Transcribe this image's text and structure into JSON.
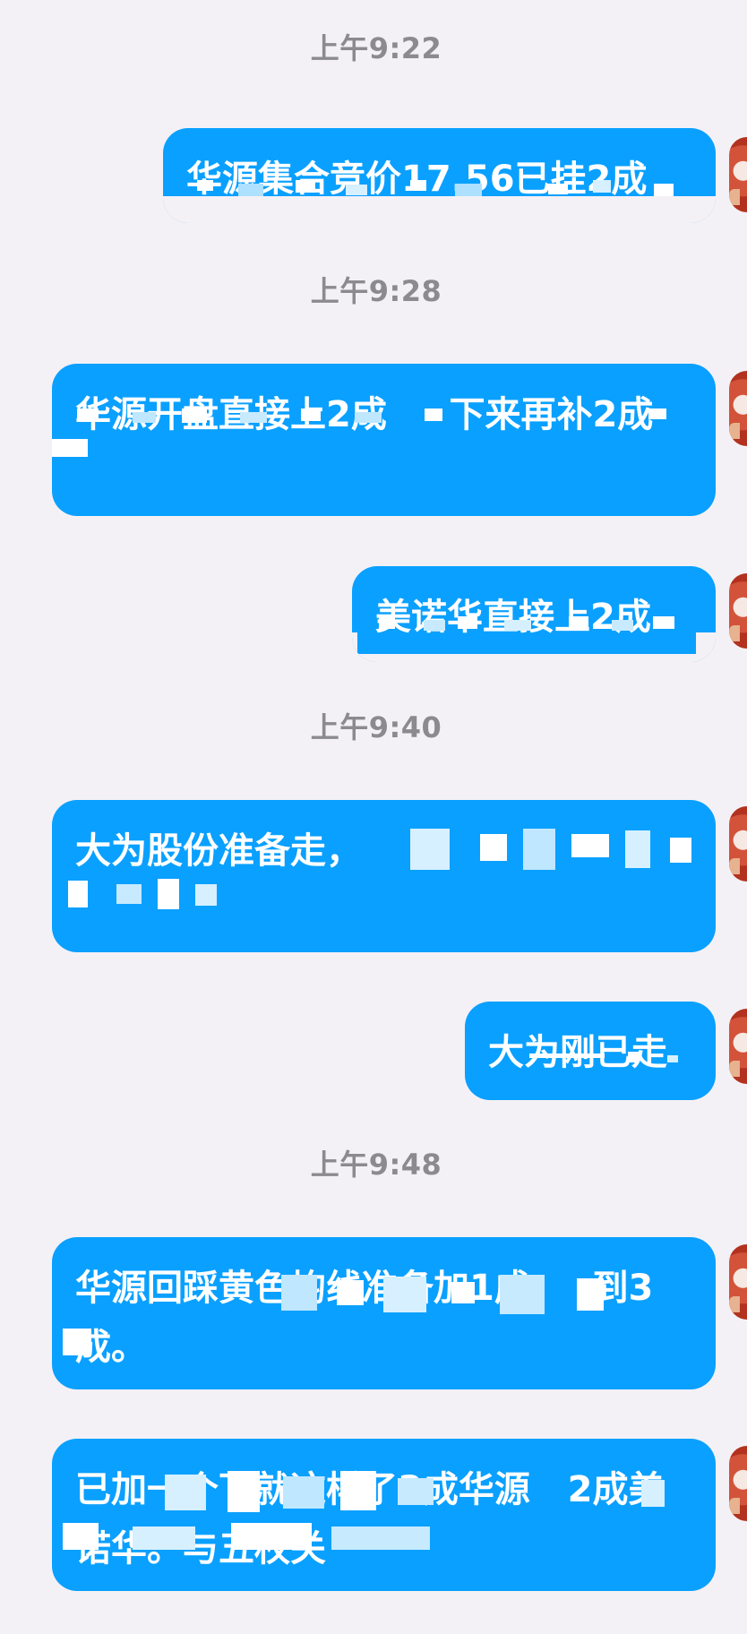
{
  "colors": {
    "background": "#f4f1f6",
    "bubble": "#0aa0ff",
    "timestamp": "#8b8b8f",
    "bubble_text": "#ffffff"
  },
  "messages": [
    {
      "time": "上午9:22",
      "text": "华源集合竞价17.56已挂2成"
    },
    {
      "time": "上午9:28",
      "text": "华源开盘直接上2成     下来再补2成"
    },
    {
      "time": "",
      "text": "美诺华直接上2成"
    },
    {
      "time": "上午9:40",
      "text": "大为股份准备走，"
    },
    {
      "time": "",
      "text": "大为刚已走"
    },
    {
      "time": "上午9:48",
      "text": "华源回踩黄色均线准备加1成     到3成。"
    },
    {
      "time": "",
      "text": "已加一个下就这样了3成华源   2成美诺华。与五权关"
    }
  ]
}
